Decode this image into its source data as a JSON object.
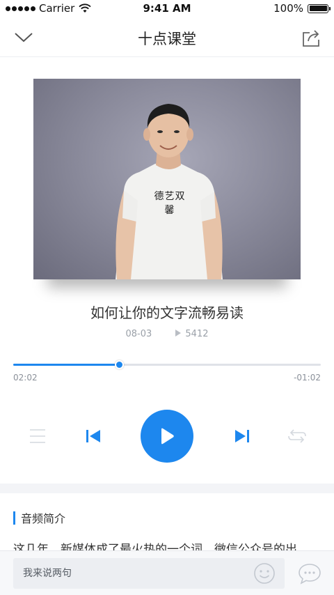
{
  "status_bar": {
    "carrier": "Carrier",
    "time": "9:41 AM",
    "battery": "100%"
  },
  "nav": {
    "title": "十点课堂",
    "back_icon": "chevron-down-icon",
    "share_icon": "share-icon"
  },
  "cover": {
    "shirt_text": "德艺双馨"
  },
  "audio": {
    "title": "如何让你的文字流畅易读",
    "date": "08-03",
    "play_count": "5412",
    "progress_fraction": 0.345,
    "elapsed": "02:02",
    "remaining": "-01:02"
  },
  "controls": {
    "playlist_icon": "playlist-icon",
    "prev_icon": "skip-previous-icon",
    "play_icon": "play-icon",
    "next_icon": "skip-next-icon",
    "loop_icon": "repeat-icon"
  },
  "intro": {
    "section_title": "音频简介",
    "text": "这几年，新媒体成了最火热的一个词，微信公众号的出"
  },
  "comment": {
    "placeholder": "我来说两句"
  },
  "colors": {
    "accent": "#1d87ee",
    "track": "#dfe2e8"
  }
}
